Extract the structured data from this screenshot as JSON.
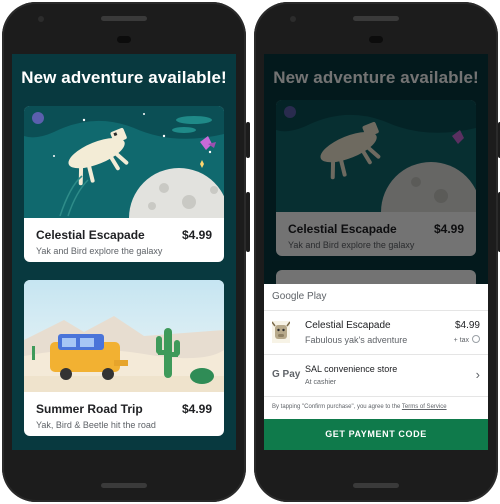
{
  "store": {
    "headline": "New adventure available!",
    "items": [
      {
        "title": "Celestial Escapade",
        "price": "$4.99",
        "subtitle": "Yak and Bird explore the galaxy"
      },
      {
        "title": "Summer Road Trip",
        "price": "$4.99",
        "subtitle": "Yak, Bird & Beetle hit the road"
      }
    ]
  },
  "payment_sheet": {
    "brand": "Google Play",
    "item": {
      "title": "Celestial Escapade",
      "subtitle": "Fabulous yak's adventure",
      "price": "$4.99",
      "tax_note": "+ tax"
    },
    "payment_method": {
      "logo_text": "G Pay",
      "name": "SAL convenience store",
      "detail": "At cashier"
    },
    "terms_prefix": "By tapping \"Confirm purchase\", you agree to the ",
    "terms_link": "Terms of Service",
    "cta_label": "GET PAYMENT CODE"
  },
  "colors": {
    "screen_bg": "#08393f",
    "cta_green": "#0f7a4b",
    "sky_teal": "#10696e",
    "desert_sky": "#cfe9f4"
  },
  "icons": [
    "info-icon",
    "chevron-right-icon",
    "yak-thumbnail-icon",
    "google-pay-logo"
  ]
}
